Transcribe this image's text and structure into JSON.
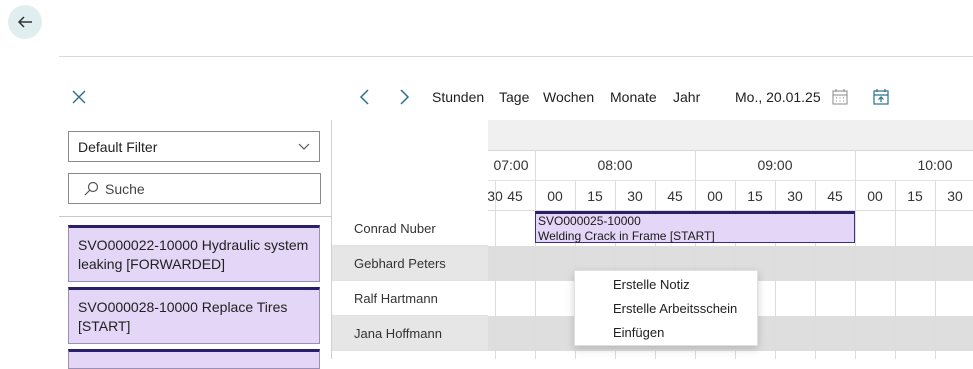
{
  "toolbar": {
    "views": [
      "Stunden",
      "Tage",
      "Wochen",
      "Monate",
      "Jahr"
    ],
    "date": "Mo., 20.01.25"
  },
  "filter": {
    "selected": "Default Filter"
  },
  "search": {
    "placeholder": "Suche"
  },
  "orders": [
    {
      "text": "SVO000022-10000 Hydraulic system leaking [FORWARDED]"
    },
    {
      "text": "SVO000028-10000 Replace Tires [START]"
    }
  ],
  "resources": [
    "Conrad Nuber",
    "Gebhard Peters",
    "Ralf Hartmann",
    "Jana Hoffmann"
  ],
  "timeline": {
    "hours": [
      "07:00",
      "08:00",
      "09:00",
      "10:00"
    ],
    "minutes": [
      "30",
      "45",
      "00",
      "15",
      "30",
      "45",
      "00",
      "15",
      "30",
      "45",
      "00",
      "15",
      "30"
    ]
  },
  "task": {
    "id": "SVO000025-10000",
    "title": "Welding Crack in Frame [START]"
  },
  "context_menu": {
    "items": [
      "Erstelle Notiz",
      "Erstelle Arbeitsschein",
      "Einfügen"
    ]
  },
  "colors": {
    "accent": "#2a6f8f",
    "card_bg": "#e3d6f6",
    "card_border": "#2a2069",
    "row_shade": "#dedede"
  }
}
